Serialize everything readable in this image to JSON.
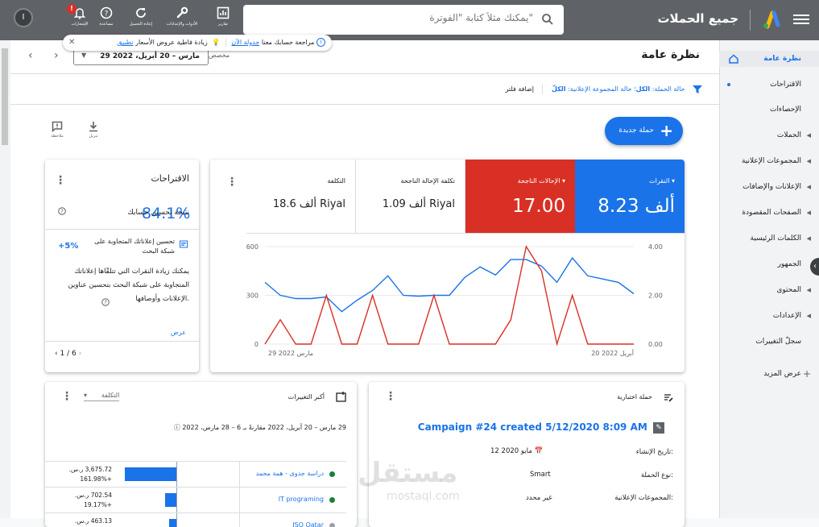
{
  "topbar": {
    "app_title": "جميع الحملات",
    "search_placeholder": "يمكنك مثلاً كتابة \"الفوترة\"",
    "buttons": [
      {
        "label": "تقارير",
        "icon": "reports-icon"
      },
      {
        "label": "الأدوات والإعدادات",
        "icon": "tools-icon"
      },
      {
        "label": "إعادة التحميل",
        "icon": "refresh-icon"
      },
      {
        "label": "مساعدة",
        "icon": "help-icon"
      },
      {
        "label": "الإشعارات",
        "icon": "bell-icon",
        "badge": "!"
      }
    ],
    "account_initial": "I"
  },
  "notice": {
    "text1": "مراجعة حسابك معنا",
    "link1": "جدولة الآن",
    "text2": "زيادة فاطية عروض الأسعار",
    "link2": "تطبيق"
  },
  "sidebar": {
    "items": [
      {
        "label": "نظرة عامة",
        "active": true
      },
      {
        "label": "الاقتراحات",
        "dot": true
      },
      {
        "label": "الإحصاءات"
      },
      {
        "label": "الحملات",
        "caret": true
      },
      {
        "label": "المجموعات الإعلانية",
        "caret": true
      },
      {
        "label": "الإعلانات والإضافات",
        "caret": true
      },
      {
        "label": "الصفحات المقصودة",
        "caret": true
      },
      {
        "label": "الكلمات الرئيسية",
        "caret": true
      },
      {
        "label": "الجمهور"
      },
      {
        "label": "المحتوى",
        "caret": true
      },
      {
        "label": "الإعدادات",
        "caret": true
      },
      {
        "label": "سجلّ التغييرات"
      },
      {
        "label": "عرض المزيد",
        "plus": true
      }
    ]
  },
  "header": {
    "title": "نظرة عامة",
    "date_range": "29 مارس – 20 أبريل، 2022",
    "date_label": "مخصص",
    "filter_text": "حالة الحملة: ",
    "filter_val1": "الكل",
    "filter_text2": "؛ حالة المجموعة الإعلانية: ",
    "filter_val2": "الكلّ",
    "add_filter": "إضافة فلتر"
  },
  "actions": {
    "new_campaign": "حملة جديدة",
    "download": "تنزيل",
    "feedback": "ملاحظة"
  },
  "suggestions": {
    "title": "الاقتراحات",
    "score_label": "نتيجة تحسين حسابك",
    "score": "84.1%",
    "item_title": "تحسين إعلاناتك المتجاوبة على شبكة البحث",
    "item_pct": "+5%",
    "desc": "يمكنك زيادة النقرات التي تتلقّاها إعلاناتك المتجاوبة على شبكة البحث بتحسين عناوين الإعلانات وأوصافها.",
    "view": "عرض",
    "pager": "1 / 6"
  },
  "metrics": [
    {
      "label": "النقرات",
      "value": "8.23 ألف",
      "color": "#1a73e8"
    },
    {
      "label": "الإحالات الناجحة",
      "value": "17.00",
      "color": "#d93025"
    },
    {
      "label": "تكلفة الإحالة الناجحة",
      "value": "1.09 ألف Riyal"
    },
    {
      "label": "التكلفة",
      "value": "18.6 ألف Riyal"
    }
  ],
  "chart_data": {
    "type": "line",
    "x_start_label": "29 مارس 2022",
    "x_end_label": "20 أبريل 2022",
    "y_left_ticks": [
      "0",
      "300",
      "600"
    ],
    "y_right_ticks": [
      "0.00",
      "2.00",
      "4.00"
    ],
    "ylim_left": [
      0,
      600
    ],
    "ylim_right": [
      0,
      4
    ],
    "series": [
      {
        "name": "النقرات",
        "color": "#1a73e8",
        "axis": "left",
        "values": [
          380,
          300,
          280,
          280,
          290,
          200,
          270,
          330,
          420,
          300,
          295,
          300,
          300,
          410,
          475,
          425,
          520,
          520,
          480,
          380,
          530,
          420,
          400,
          380,
          310
        ]
      },
      {
        "name": "الإحالات الناجحة",
        "color": "#d93025",
        "axis": "right",
        "values": [
          0,
          1,
          0,
          0,
          2,
          0,
          0,
          2,
          0,
          0,
          0,
          2,
          0,
          0,
          0,
          0,
          1,
          4,
          3,
          0,
          2,
          0,
          0,
          0,
          0
        ]
      }
    ]
  },
  "changes_table": {
    "title": "أكبر التغييرات",
    "sort_label": "التكلفة",
    "range": "29 مارس – 20 أبريل، 2022 مقارنةً بـ 6 – 28 مارس، 2022",
    "rows": [
      {
        "name": "دراسة جدوى - همة محمد",
        "value": "3,675.72 ر.س.",
        "change": "+161.98%",
        "bar": 0.75,
        "status": "green"
      },
      {
        "name": "IT programing",
        "value": "702.54 ر.س.",
        "change": "+19.17%",
        "bar": 0.16,
        "status": "green"
      },
      {
        "name": "ISO Qatar",
        "value": "463.13 ر.س.",
        "change": "",
        "bar": 0.1,
        "status": "gray"
      }
    ]
  },
  "campaign_card": {
    "title": "حملة اختبارية",
    "name": "Campaign #24 created 5/12/2020 8:09 AM",
    "fields": [
      {
        "label": "تاريخ الإنشاء:",
        "value": "12 مايو 2020"
      },
      {
        "label": "نوع الحملة:",
        "value": "Smart"
      },
      {
        "label": "المجموعات الإعلانية:",
        "value": "غير محدد"
      }
    ]
  },
  "watermark": {
    "text": "مستقل",
    "sub": "mostaql.com"
  }
}
